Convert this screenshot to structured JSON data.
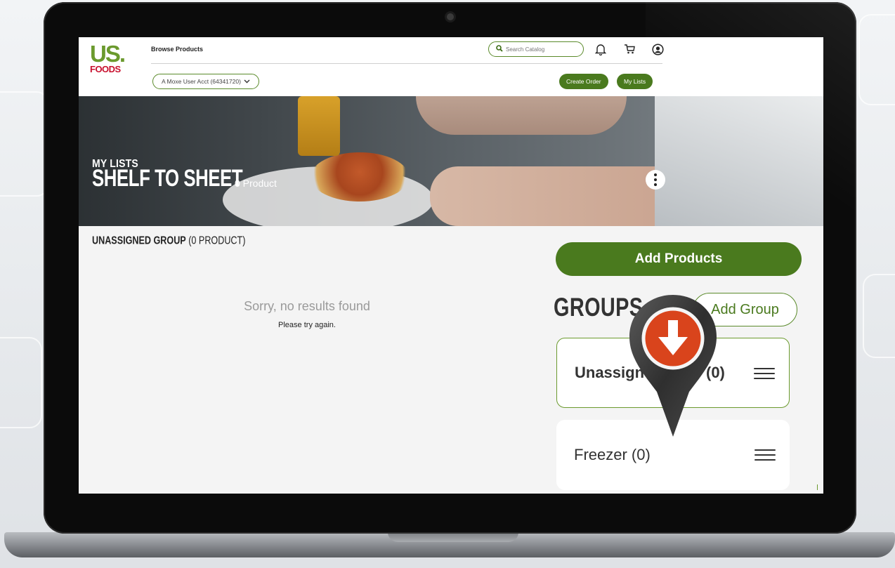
{
  "header": {
    "logo_top": "US.",
    "logo_bottom": "FOODS",
    "browse_label": "Browse Products",
    "search_placeholder": "Search Catalog",
    "account_label": "A Moxe User Acct (64341720)",
    "create_order_label": "Create Order",
    "my_lists_label": "My Lists"
  },
  "hero": {
    "label": "MY LISTS",
    "title": "SHELF TO SHEET",
    "count": "0 Product"
  },
  "main": {
    "group_heading_bold": "UNASSIGNED GROUP",
    "group_heading_count": "(0 PRODUCT)",
    "empty_title": "Sorry, no results found",
    "empty_subtitle": "Please try again."
  },
  "sidebar": {
    "add_products_label": "Add Products",
    "groups_title": "GROUPS",
    "add_group_label": "Add Group",
    "groups": [
      {
        "name": "Unassigned",
        "count": "(0)"
      },
      {
        "name": "Freezer (0)"
      }
    ]
  },
  "overlay": {
    "icon": "download-arrow-icon"
  },
  "colors": {
    "brand_green": "#4a7a1e",
    "logo_green": "#6b9a2e",
    "logo_red": "#c8102e",
    "pin_orange": "#d9441c"
  }
}
